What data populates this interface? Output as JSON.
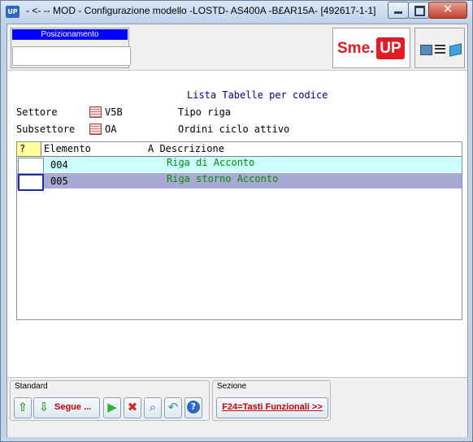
{
  "window": {
    "app_icon": "UP",
    "title": "- <- -- MOD - Configurazione modello -LOSTD- AS400A -B£AR15A- [492617-1-1]"
  },
  "top": {
    "posizionamento_label": "Posizionamento",
    "posizionamento_value": "",
    "logo_sme": "Sme.",
    "logo_up": "UP",
    "icons": [
      "computer-icon",
      "list-icon",
      "book-icon"
    ]
  },
  "header": {
    "list_title": "Lista Tabelle per codice",
    "settore_label": "Settore",
    "settore_code": "V5B",
    "settore_desc": "Tipo riga",
    "subsettore_label": "Subsettore",
    "subsettore_code": "OA",
    "subsettore_desc": "Ordini ciclo attivo"
  },
  "table": {
    "columns": [
      "?",
      "Elemento",
      "A Descrizione"
    ],
    "rows": [
      {
        "code": "004",
        "desc": "Riga di Acconto"
      },
      {
        "code": "005",
        "desc": "Riga storno Acconto"
      }
    ]
  },
  "bottom": {
    "standard_label": "Standard",
    "segue_label": "Segue ...",
    "sezione_label": "Sezione",
    "f24_label": "F24=Tasti Funzionali >>"
  },
  "colors": {
    "row1_bg": "#ccffff",
    "row2_bg": "#a9a9d6",
    "desc_text": "#009000",
    "brand_red": "#e11b22",
    "pos_label_bg": "#0000ff"
  }
}
